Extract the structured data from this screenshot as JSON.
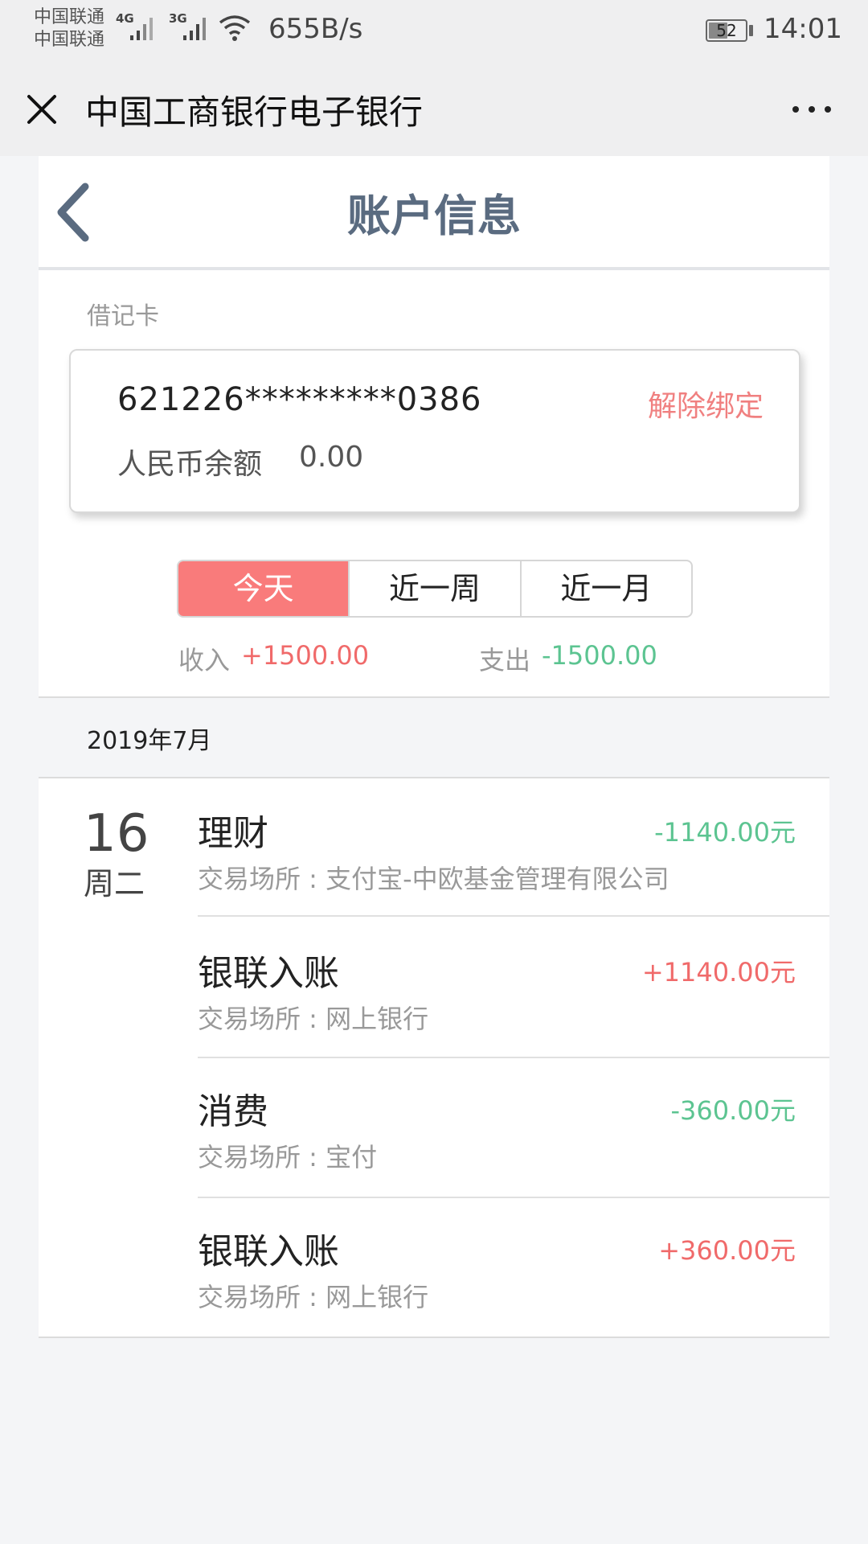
{
  "status_bar": {
    "carrier_1": "中国联通",
    "carrier_2": "中国联通",
    "network_1": "4G",
    "network_2": "3G",
    "net_speed": "655B/s",
    "battery_level": "52",
    "time": "14:01"
  },
  "header": {
    "title": "中国工商银行电子银行"
  },
  "nav": {
    "title": "账户信息"
  },
  "card": {
    "section_label": "借记卡",
    "number": "621226*********0386",
    "unbind_label": "解除绑定",
    "balance_label": "人民币余额",
    "balance_value": "0.00"
  },
  "periods": {
    "tabs": [
      "今天",
      "近一周",
      "近一月"
    ],
    "selected": "今天"
  },
  "summary": {
    "income_label": "收入",
    "income_value": "+1500.00",
    "expense_label": "支出",
    "expense_value": "-1500.00"
  },
  "list": {
    "month": "2019年7月",
    "day": "16",
    "weekday": "周二",
    "transactions": [
      {
        "title": "理财",
        "place": "交易场所 : 支付宝-中欧基金管理有限公司",
        "amount": "-1140.00元"
      },
      {
        "title": "银联入账",
        "place": "交易场所 : 网上银行",
        "amount": "+1140.00元"
      },
      {
        "title": "消费",
        "place": "交易场所 : 宝付",
        "amount": "-360.00元"
      },
      {
        "title": "银联入账",
        "place": "交易场所 : 网上银行",
        "amount": "+360.00元"
      }
    ]
  },
  "colors": {
    "accent": "#f97b7b",
    "income": "#f06a6a",
    "expense": "#5cc491",
    "nav_title": "#5a6b80"
  },
  "icons": {
    "close": "close-icon",
    "more": "more-icon",
    "back": "chevron-left-icon"
  }
}
